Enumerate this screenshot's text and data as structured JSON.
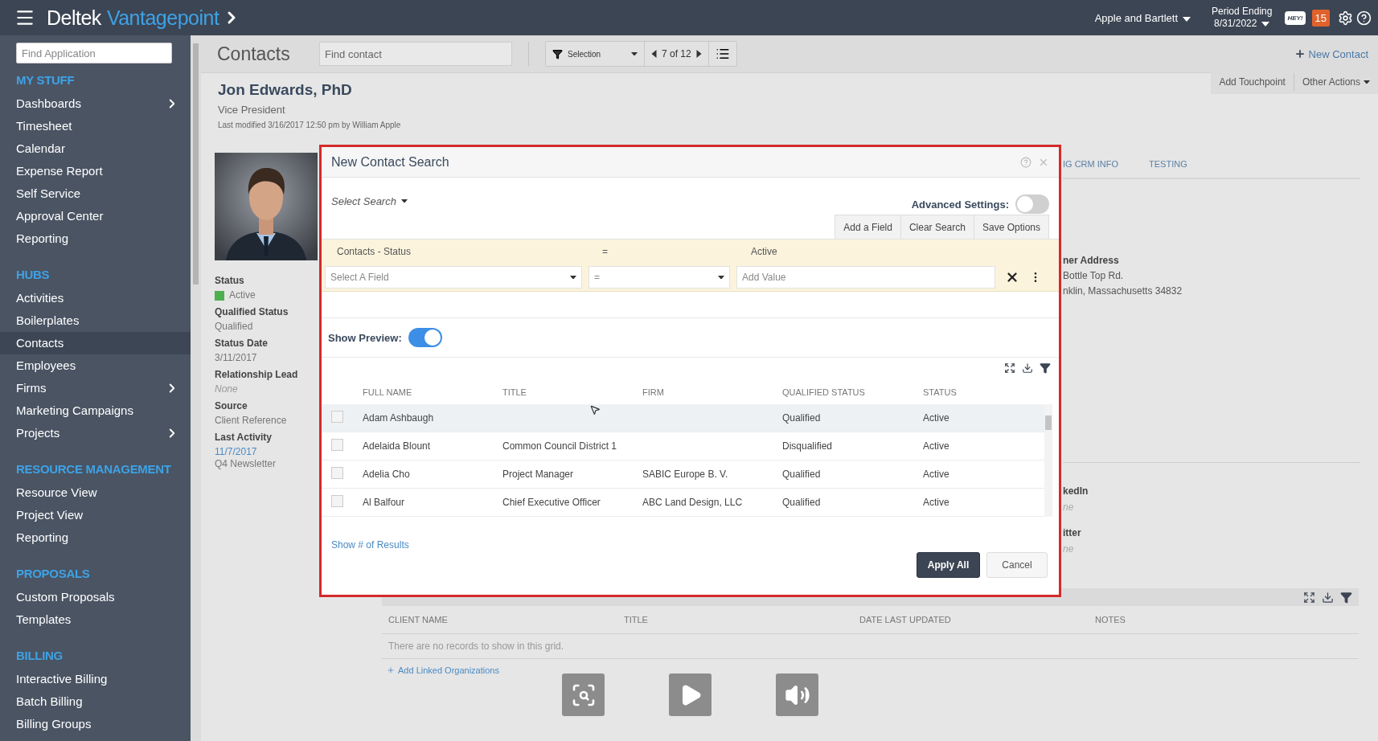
{
  "top_bar": {
    "brand": "Deltek",
    "product": "Vantagepoint",
    "company": "Apple and Bartlett",
    "period_label": "Period Ending",
    "period_date": "8/31/2022",
    "chat_label": "HEY!",
    "notifications": "15"
  },
  "sidebar": {
    "search_placeholder": "Find Application",
    "sections": [
      {
        "title": "MY STUFF",
        "items": [
          {
            "label": "Dashboards",
            "has_children": true,
            "selected": false
          },
          {
            "label": "Timesheet",
            "has_children": false,
            "selected": false
          },
          {
            "label": "Calendar",
            "has_children": false,
            "selected": false
          },
          {
            "label": "Expense Report",
            "has_children": false,
            "selected": false
          },
          {
            "label": "Self Service",
            "has_children": false,
            "selected": false
          },
          {
            "label": "Approval Center",
            "has_children": false,
            "selected": false
          },
          {
            "label": "Reporting",
            "has_children": false,
            "selected": false
          }
        ]
      },
      {
        "title": "HUBS",
        "items": [
          {
            "label": "Activities",
            "has_children": false,
            "selected": false
          },
          {
            "label": "Boilerplates",
            "has_children": false,
            "selected": false
          },
          {
            "label": "Contacts",
            "has_children": false,
            "selected": true
          },
          {
            "label": "Employees",
            "has_children": false,
            "selected": false
          },
          {
            "label": "Firms",
            "has_children": true,
            "selected": false
          },
          {
            "label": "Marketing Campaigns",
            "has_children": false,
            "selected": false
          },
          {
            "label": "Projects",
            "has_children": true,
            "selected": false
          }
        ]
      },
      {
        "title": "RESOURCE MANAGEMENT",
        "items": [
          {
            "label": "Resource View",
            "has_children": false,
            "selected": false
          },
          {
            "label": "Project View",
            "has_children": false,
            "selected": false
          },
          {
            "label": "Reporting",
            "has_children": false,
            "selected": false
          }
        ]
      },
      {
        "title": "PROPOSALS",
        "items": [
          {
            "label": "Custom Proposals",
            "has_children": false,
            "selected": false
          },
          {
            "label": "Templates",
            "has_children": false,
            "selected": false
          }
        ]
      },
      {
        "title": "BILLING",
        "items": [
          {
            "label": "Interactive Billing",
            "has_children": false,
            "selected": false
          },
          {
            "label": "Batch Billing",
            "has_children": false,
            "selected": false
          },
          {
            "label": "Billing Groups",
            "has_children": false,
            "selected": false
          }
        ]
      }
    ]
  },
  "header": {
    "title": "Contacts",
    "search_placeholder": "Find contact",
    "filter_label": "Selection",
    "pager": "7 of 12",
    "new_button": "New Contact"
  },
  "contact": {
    "name": "Jon Edwards, PhD",
    "job_title": "Vice President",
    "modified": "Last modified 3/16/2017 12:50 pm by William Apple",
    "actions": [
      "Add Touchpoint",
      "Other Actions"
    ],
    "fields": [
      {
        "label": "Status",
        "kind": "status",
        "value": "Active",
        "color": "#4caf50"
      },
      {
        "label": "Qualified Status",
        "kind": "text",
        "value": "Qualified"
      },
      {
        "label": "Status Date",
        "kind": "text",
        "value": "3/11/2017"
      },
      {
        "label": "Relationship Lead",
        "kind": "empty",
        "value": "None"
      },
      {
        "label": "Source",
        "kind": "text",
        "value": "Client Reference"
      },
      {
        "label": "Last Activity",
        "kind": "link",
        "value": "11/7/2017",
        "note": "Q4 Newsletter"
      }
    ]
  },
  "tabs": [
    {
      "label": "IG CRM INFO",
      "selected": false
    },
    {
      "label": "TESTING",
      "selected": false
    }
  ],
  "address": {
    "label": "ner Address",
    "lines": [
      "Bottle Top Rd.",
      "nklin, Massachusetts 34832"
    ]
  },
  "social": [
    {
      "label": "kedIn",
      "value": "ne"
    },
    {
      "label": "itter",
      "value": "ne"
    }
  ],
  "linked_grid": {
    "columns": [
      "CLIENT NAME",
      "TITLE",
      "DATE LAST UPDATED",
      "NOTES"
    ],
    "empty_text": "There are no records to show in this grid.",
    "add_link": "Add Linked Organizations"
  },
  "search_dialog": {
    "title": "New Contact Search",
    "select_search": "Select Search",
    "advanced_label": "Advanced Settings:",
    "advanced_on": false,
    "buttons": [
      "Add a Field",
      "Clear Search",
      "Save Options"
    ],
    "criteria": {
      "field": "Contacts - Status",
      "operator": "=",
      "value": "Active"
    },
    "new_criterion": {
      "field_placeholder": "Select A Field",
      "operator": "=",
      "value_placeholder": "Add Value"
    },
    "preview_label": "Show Preview:",
    "preview_on": true,
    "results": {
      "columns": [
        "FULL NAME",
        "TITLE",
        "FIRM",
        "QUALIFIED STATUS",
        "STATUS"
      ],
      "rows": [
        {
          "cells": [
            "Adam Ashbaugh",
            "",
            "",
            "Qualified",
            "Active"
          ],
          "checked": false,
          "selected": true
        },
        {
          "cells": [
            "Adelaida Blount",
            "Common Council District 1",
            "",
            "Disqualified",
            "Active"
          ],
          "checked": false,
          "selected": false
        },
        {
          "cells": [
            "Adelia Cho",
            "Project Manager",
            "SABIC Europe B. V.",
            "Qualified",
            "Active"
          ],
          "checked": false,
          "selected": false
        },
        {
          "cells": [
            "Al Balfour",
            "Chief Executive Officer",
            "ABC Land Design, LLC",
            "Qualified",
            "Active"
          ],
          "checked": false,
          "selected": false
        }
      ]
    },
    "results_link": "Show # of Results",
    "apply": "Apply All",
    "cancel": "Cancel"
  }
}
